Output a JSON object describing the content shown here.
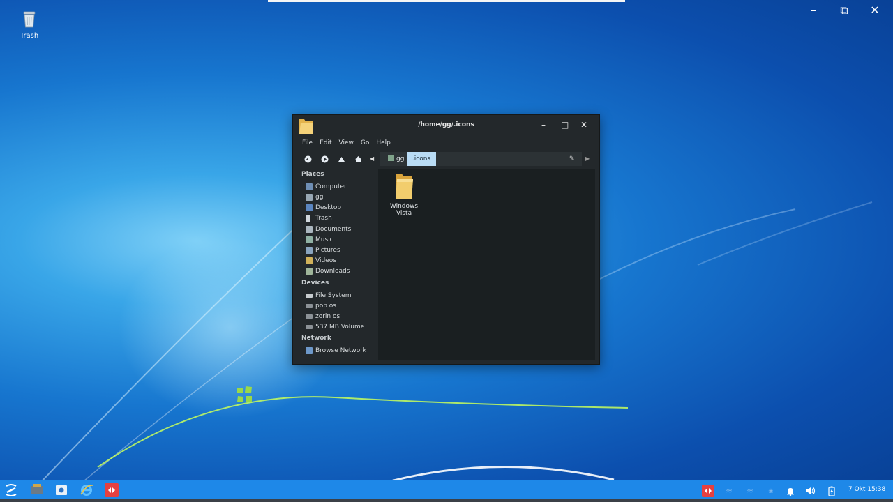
{
  "desktop": {
    "trash_label": "Trash"
  },
  "window": {
    "title": "/home/gg/.icons",
    "menu": [
      "File",
      "Edit",
      "View",
      "Go",
      "Help"
    ],
    "breadcrumbs": [
      "gg",
      ".icons"
    ]
  },
  "sidebar": {
    "places_header": "Places",
    "places": [
      "Computer",
      "gg",
      "Desktop",
      "Trash",
      "Documents",
      "Music",
      "Pictures",
      "Videos",
      "Downloads"
    ],
    "devices_header": "Devices",
    "devices": [
      "File System",
      "pop os",
      "zorin os",
      "537 MB Volume"
    ],
    "network_header": "Network",
    "network": [
      "Browse Network"
    ]
  },
  "content": {
    "items": [
      "Windows Vista"
    ]
  },
  "taskbar": {
    "clock": "7 Okt 15:38"
  },
  "colors": {
    "taskbar": "#1e88e8",
    "window_bg": "#23282b",
    "crumb_active": "#b9dcf5"
  }
}
